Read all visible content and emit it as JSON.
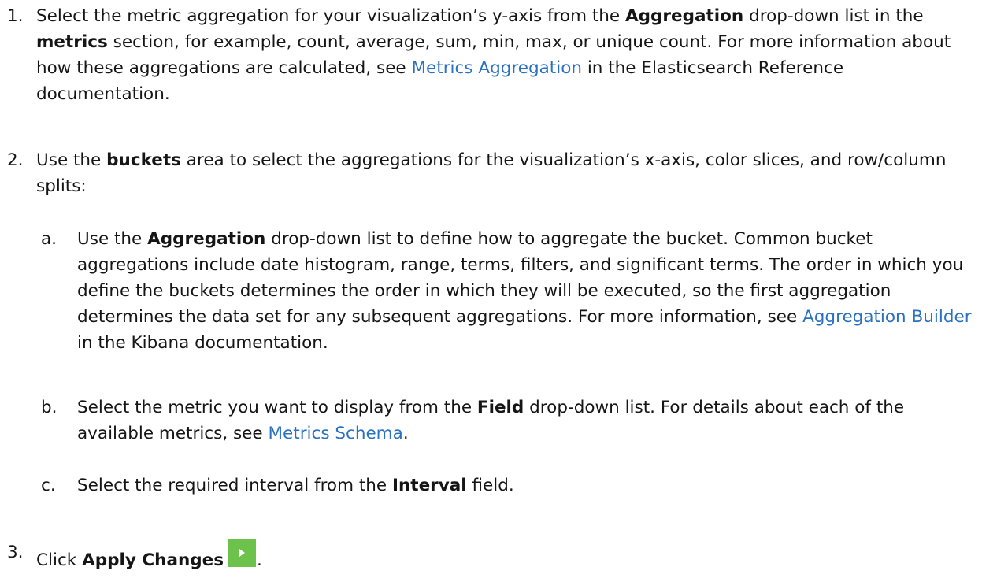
{
  "steps": [
    {
      "number": "1.",
      "parts": [
        "Select the metric aggregation for your visualization’s y-axis from the ",
        "Aggregation",
        " drop-down list in the ",
        "metrics",
        " section, for example, count, average, sum, min, max, or unique count. For more information about how these aggregations are calculated, see ",
        "Metrics Aggregation",
        " in the Elasticsearch Reference documentation."
      ]
    },
    {
      "number": "2.",
      "parts": [
        "Use the ",
        "buckets",
        " area to select the aggregations for the visualization’s x-axis, color slices, and row/column splits:"
      ],
      "substeps": [
        {
          "letter": "a.",
          "parts": [
            "Use the ",
            "Aggregation",
            " drop-down list to define how to aggregate the bucket. Common bucket aggregations include date histogram, range, terms, filters, and significant terms. The order in which you define the buckets determines the order in which they will be executed, so the first aggregation determines the data set for any subsequent aggregations. For more information, see ",
            "Aggregation Builder",
            " in the Kibana documentation."
          ]
        },
        {
          "letter": "b.",
          "parts": [
            "Select the metric you want to display from the ",
            "Field",
            " drop-down list. For details about each of the available metrics, see ",
            "Metrics Schema",
            "."
          ]
        },
        {
          "letter": "c.",
          "parts": [
            "Select the required interval from the ",
            "Interval",
            " field."
          ]
        }
      ]
    },
    {
      "number": "3.",
      "parts": [
        "Click ",
        "Apply Changes",
        "."
      ],
      "icon": "play-icon"
    }
  ],
  "colors": {
    "link": "#2b71c2",
    "apply_button": "#6cc24a"
  }
}
